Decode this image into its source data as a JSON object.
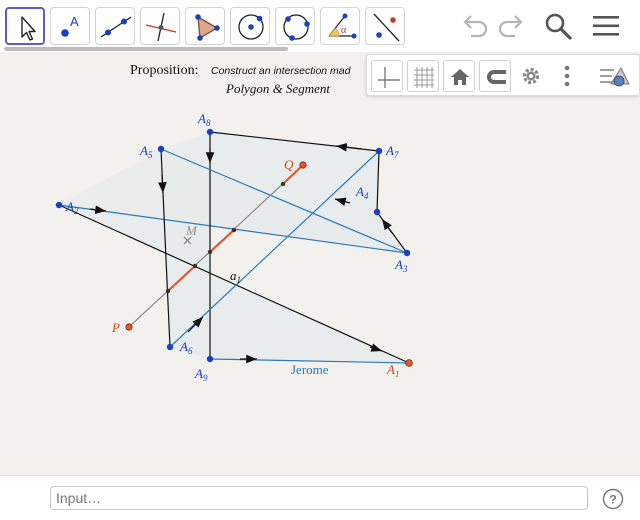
{
  "toolbar": {
    "tools": [
      {
        "id": "move",
        "name": "move-tool",
        "active": true
      },
      {
        "id": "point",
        "name": "point-tool",
        "glyph": "A"
      },
      {
        "id": "line",
        "name": "line-tool"
      },
      {
        "id": "perpendicular",
        "name": "perpendicular-line-tool"
      },
      {
        "id": "polygon",
        "name": "polygon-tool"
      },
      {
        "id": "circle-center",
        "name": "circle-center-point-tool"
      },
      {
        "id": "circle-3pts",
        "name": "circle-three-points-tool"
      },
      {
        "id": "angle",
        "name": "angle-tool",
        "glyph": "α"
      },
      {
        "id": "reflect",
        "name": "reflect-about-line-tool"
      }
    ]
  },
  "header": {
    "undo": "undo-icon",
    "redo": "redo-icon",
    "search": "search-icon",
    "menu": "menu-icon"
  },
  "stylebar": {
    "buttons": [
      "axes-icon",
      "grid-icon",
      "home-icon",
      "magnet-icon",
      "gear-icon",
      "more-vertical-icon",
      "toggle-style-bar-icon"
    ]
  },
  "canvas": {
    "proposition_label": "Proposition:",
    "proposition_text": "Construct an intersection mad",
    "subtitle": "Polygon & Segment",
    "author": "Jerome",
    "colors": {
      "background": "#f3f1ed",
      "polygon_fill": "#e6ebeb",
      "blue": "#1565c0",
      "edge_blue": "#2b7bb9",
      "black": "#111111",
      "orange": "#e4572e",
      "gray": "#8c8c8c",
      "label_blue": "#1a3fc4",
      "label_orange": "#d84315"
    },
    "points": [
      {
        "name": "A",
        "sub": "1",
        "color": "orange"
      },
      {
        "name": "A",
        "sub": "2",
        "color": "blue"
      },
      {
        "name": "A",
        "sub": "3",
        "color": "blue"
      },
      {
        "name": "A",
        "sub": "4",
        "color": "blue"
      },
      {
        "name": "A",
        "sub": "5",
        "color": "blue"
      },
      {
        "name": "A",
        "sub": "6",
        "color": "blue"
      },
      {
        "name": "A",
        "sub": "7",
        "color": "blue"
      },
      {
        "name": "A",
        "sub": "8",
        "color": "blue"
      },
      {
        "name": "A",
        "sub": "9",
        "color": "blue"
      },
      {
        "name": "P",
        "sub": "",
        "color": "orange"
      },
      {
        "name": "Q",
        "sub": "",
        "color": "orange"
      },
      {
        "name": "M",
        "sub": "",
        "color": "gray"
      }
    ],
    "segment_label": {
      "name": "a",
      "sub": "1"
    }
  },
  "inputbar": {
    "placeholder": "Input…",
    "help_icon": "help-icon"
  }
}
